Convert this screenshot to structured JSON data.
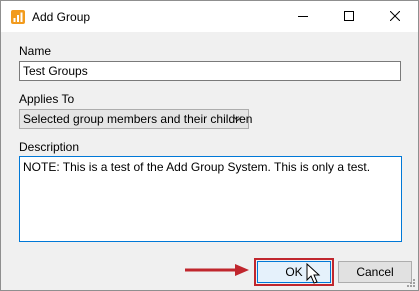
{
  "window": {
    "title": "Add Group",
    "icon": "chart-bars-icon",
    "controls": [
      "minimize-icon",
      "maximize-icon",
      "close-icon"
    ]
  },
  "form": {
    "name_label": "Name",
    "name_value": "Test Groups",
    "applies_label": "Applies To",
    "applies_value": "Selected group members and their children",
    "description_label": "Description",
    "description_value": "NOTE: This is a test of the Add Group System. This is only a test."
  },
  "buttons": {
    "ok_label": "OK",
    "cancel_label": "Cancel"
  },
  "annotation": {
    "arrow_color": "#c0262d",
    "highlight_color": "#c0262d"
  }
}
